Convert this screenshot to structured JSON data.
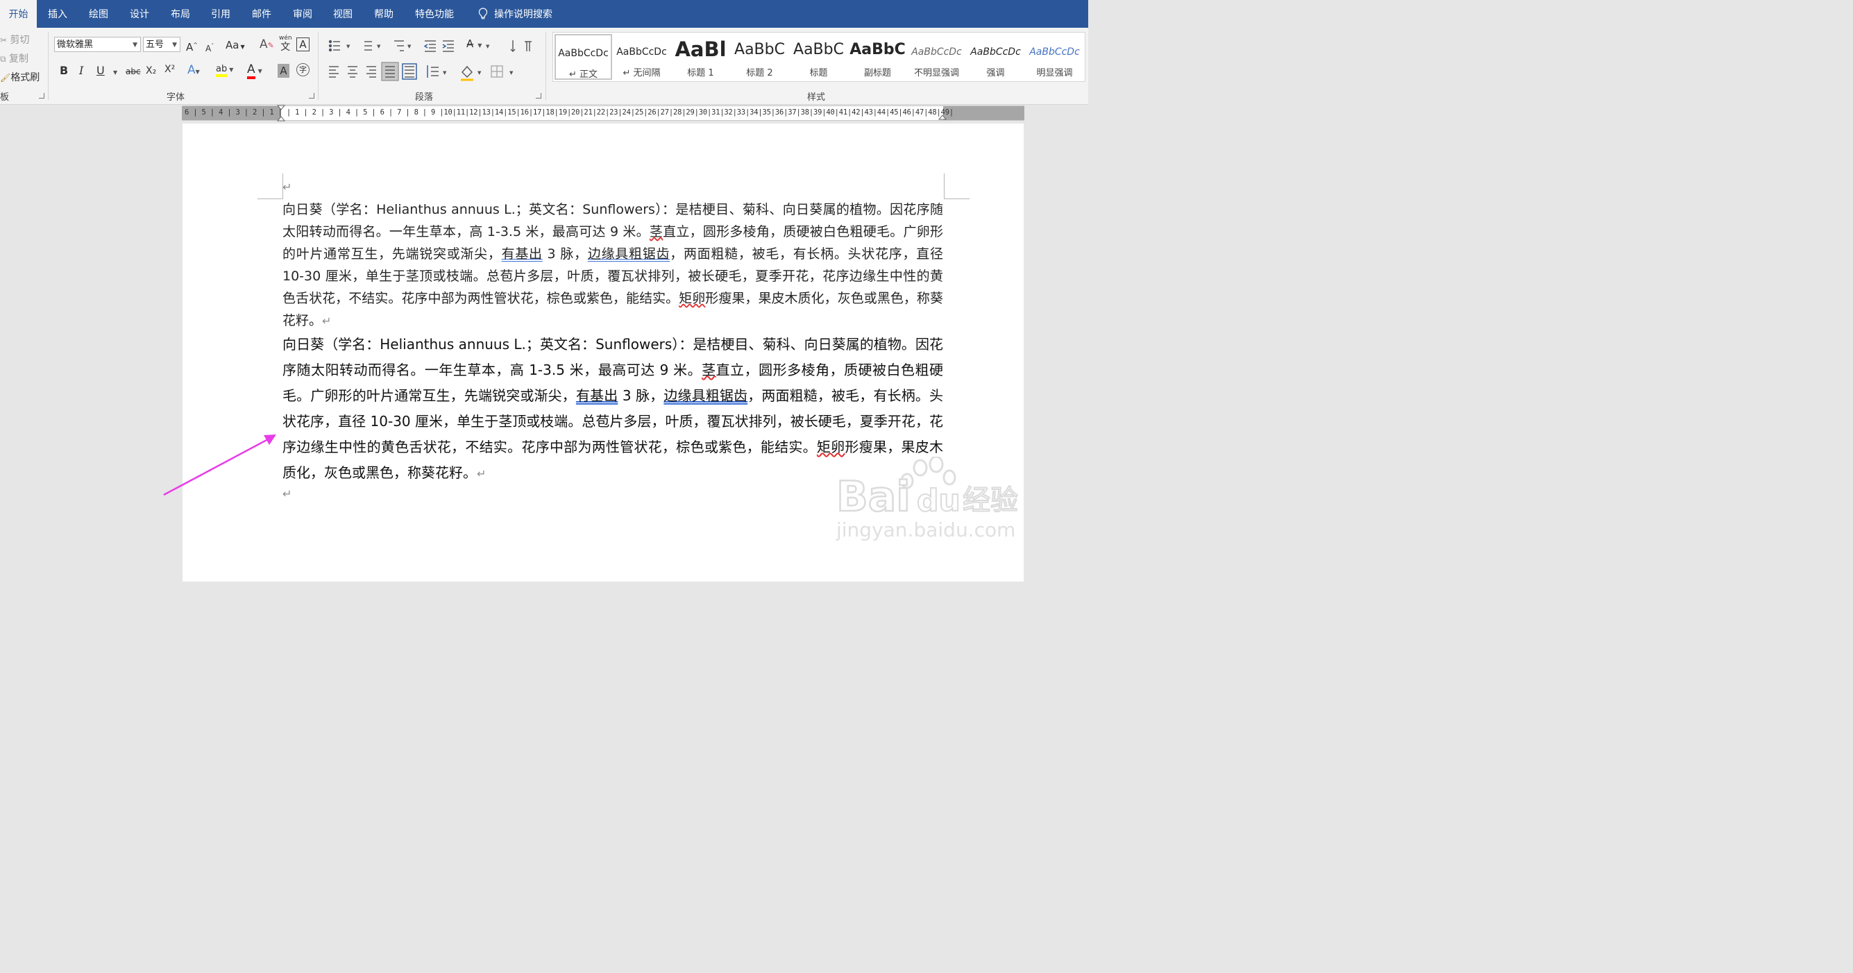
{
  "tabs": [
    {
      "label": "开始",
      "active": true
    },
    {
      "label": "插入"
    },
    {
      "label": "绘图"
    },
    {
      "label": "设计"
    },
    {
      "label": "布局"
    },
    {
      "label": "引用"
    },
    {
      "label": "邮件"
    },
    {
      "label": "审阅"
    },
    {
      "label": "视图"
    },
    {
      "label": "帮助"
    },
    {
      "label": "特色功能"
    }
  ],
  "tell_me": "操作说明搜索",
  "clipboard": {
    "cut": "剪切",
    "copy": "复制",
    "format_painter": "格式刷",
    "label": "板"
  },
  "font": {
    "name": "微软雅黑",
    "size": "五号",
    "label": "字体",
    "clear_format_glyph": "A",
    "phonetic_top": "wén",
    "phonetic_bottom": "文",
    "bold": "B",
    "italic": "I",
    "underline": "U",
    "strike": "abc",
    "sub": "X₂",
    "sup": "X²",
    "grow": "A",
    "shrink": "A",
    "case": "Aa",
    "highlight_glyph": "ab",
    "font_color_glyph": "A",
    "char_shade_glyph": "A",
    "enclose": "字"
  },
  "paragraph": {
    "label": "段落"
  },
  "styles": {
    "label": "样式",
    "items": [
      {
        "sample": "AaBbCcDc",
        "name": "↵ 正文",
        "selected": true
      },
      {
        "sample": "AaBbCcDc",
        "name": "↵ 无间隔"
      },
      {
        "sample": "AaBl",
        "name": "标题 1"
      },
      {
        "sample": "AaBbC",
        "name": "标题 2"
      },
      {
        "sample": "AaBbC",
        "name": "标题"
      },
      {
        "sample": "AaBbC",
        "name": "副标题"
      },
      {
        "sample": "AaBbCcDc",
        "name": "不明显强调"
      },
      {
        "sample": "AaBbCcDc",
        "name": "强调"
      },
      {
        "sample": "AaBbCcDc",
        "name": "明显强调"
      }
    ]
  },
  "ruler": {
    "text": "6 | 5 | 4 | 3 | 2 | 1 |    | 1 | 2 | 3 | 4 | 5 | 6 | 7 | 8 | 9 |10|11|12|13|14|15|16|17|18|19|20|21|22|23|24|25|26|27|28|29|30|31|32|33|34|35|36|37|38|39|40|41|42|43|44|45|46|47|48|49|"
  },
  "document": {
    "p1_parts": [
      "向日葵（学名：Helianthus annuus L.；英文名：Sunflowers）：是桔梗目、菊科、向日葵属的植物。因花序随太阳转动而得名。一年生草本，高 1-3.5 米，最高可达 9 米。",
      "茎",
      "直立，圆形多棱角，质硬被白色粗硬毛。广卵形的叶片通常互生，先端锐突或渐尖，",
      "有基出",
      " 3 脉，",
      "边缘具粗锯齿",
      "，两面粗糙，被毛，有长柄。头状花序，直径 10-30 厘米，单生于茎顶或枝端。总苞片多层，叶质，覆瓦状排列，被长硬毛，夏季开花，花序边缘生中性的黄色舌状花，不结实。花序中部为两性管状花，棕色或紫色，能结实。",
      "矩卵",
      "形瘦果，果皮木质化，灰色或黑色，称葵花籽。"
    ],
    "p2_parts": [
      "向日葵（学名：Helianthus annuus L.；英文名：Sunflowers）：是桔梗目、菊科、向日葵属的植物。因花序随太阳转动而得名。一年生草本，高 1-3.5 米，最高可达 9 米。",
      "茎",
      "直立，圆形多棱角，质硬被白色粗硬毛。广卵形的叶片通常互生，先端锐突或渐尖，",
      "有基出",
      " 3 脉，",
      "边缘具粗锯齿",
      "，两面粗糙，被毛，有长柄。头状花序，直径 10-30 厘米，单生于茎顶或枝端。总苞片多层，叶质，覆瓦状排列，被长硬毛，夏季开花，花序边缘生中性的黄色舌状花，不结实。花序中部为两性管状花，棕色或紫色，能结实。",
      "矩卵",
      "形瘦果，果皮木质化，灰色或黑色，称葵花籽。"
    ],
    "para_mark": "↵"
  },
  "watermark": {
    "brand": "Bai",
    "brand_suffix": "du",
    "brand_cn": "经验",
    "url": "jingyan.baidu.com"
  },
  "colors": {
    "tab_bar": "#2b579a",
    "arrow": "#e83ce8",
    "spell_red": "#e03131",
    "grammar_blue": "#3b6fd4"
  }
}
